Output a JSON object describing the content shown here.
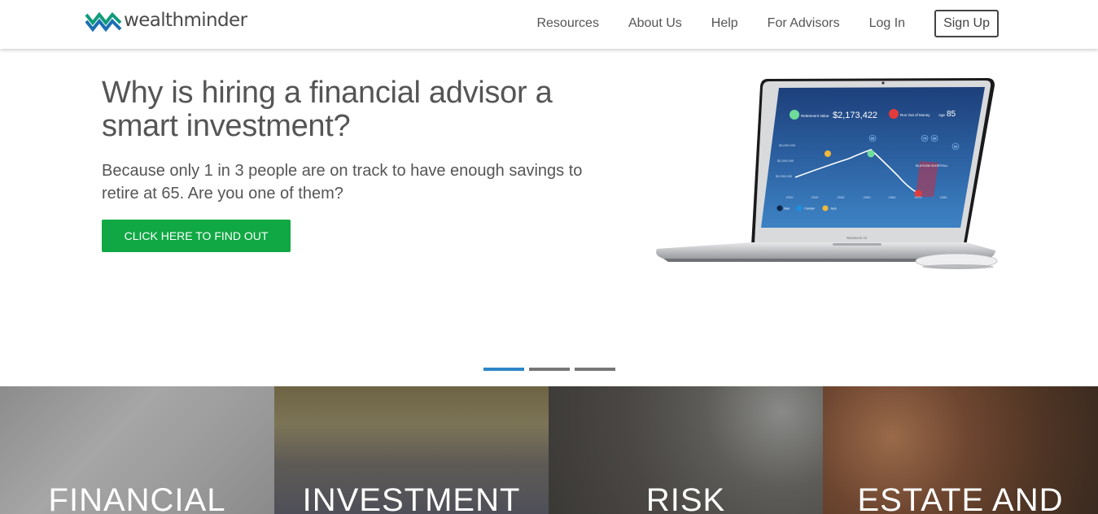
{
  "brand": {
    "name": "wealthminder",
    "green": "#10a844",
    "blue": "#1b6fb3"
  },
  "nav": {
    "links": [
      "Resources",
      "About Us",
      "Help",
      "For Advisors",
      "Log In"
    ],
    "signup": "Sign Up"
  },
  "hero": {
    "title": "Why is hiring a financial advisor a smart investment?",
    "subtitle": "Because only 1 in 3 people are on track to have enough savings to retire at 65. Are you one of them?",
    "cta": "CLICK HERE TO FIND OUT"
  },
  "laptop_screen": {
    "retirement_label": "Retirement Value",
    "retirement_value": "$2,173,422",
    "run_out_label": "Run Out of Money",
    "age_label": "Age",
    "age_value": "85",
    "y_ticks": [
      "$3,000,000",
      "$2,000,000",
      "$1,000,000"
    ],
    "x_ticks": [
      "2020",
      "2030",
      "2040",
      "2050",
      "2060",
      "2070",
      "2080"
    ],
    "markers": [
      "65",
      "74",
      "90",
      "92"
    ],
    "shortfall": "$3,679,530 SHORTFALL",
    "legend": [
      "Kyle",
      "Carolyn",
      "Jack"
    ],
    "laptop_brand": "MacBook Air"
  },
  "carousel": {
    "slides": 3,
    "active": 1
  },
  "tiles": [
    "FINANCIAL",
    "INVESTMENT",
    "RISK",
    "ESTATE AND"
  ]
}
